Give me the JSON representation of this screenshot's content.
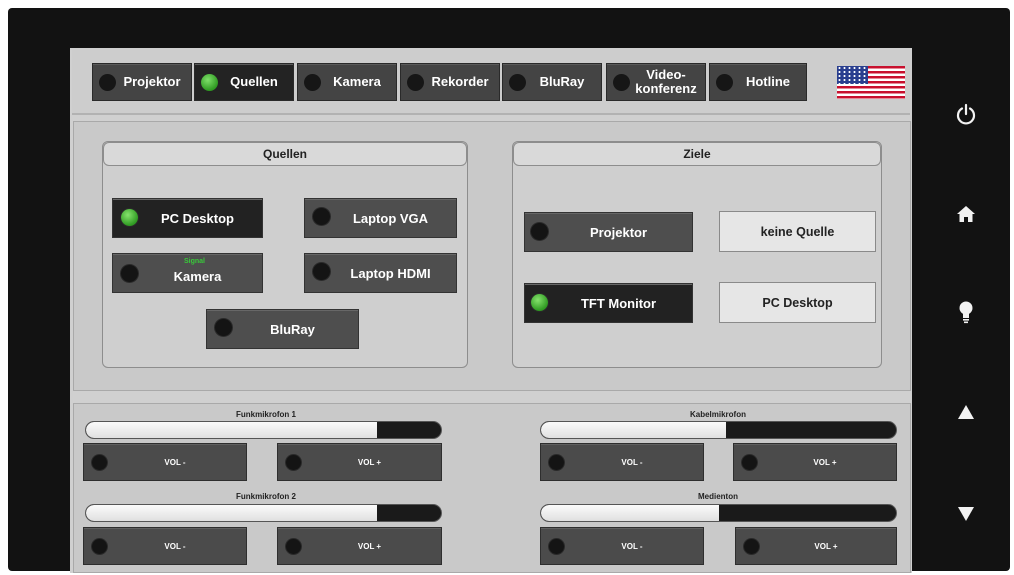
{
  "nav": [
    {
      "label": "Projektor",
      "active": false
    },
    {
      "label": "Quellen",
      "active": true
    },
    {
      "label": "Kamera",
      "active": false
    },
    {
      "label": "Rekorder",
      "active": false
    },
    {
      "label": "BluRay",
      "active": false
    },
    {
      "label": "Video-\nkonferenz",
      "active": false
    },
    {
      "label": "Hotline",
      "active": false
    }
  ],
  "language_flag": "us-flag-icon",
  "sources": {
    "title": "Quellen",
    "buttons": [
      {
        "label": "PC Desktop",
        "active": true
      },
      {
        "label": "Laptop VGA",
        "active": false
      },
      {
        "label": "Kamera",
        "active": false,
        "note": "Signal"
      },
      {
        "label": "Laptop HDMI",
        "active": false
      },
      {
        "label": "BluRay",
        "active": false
      }
    ]
  },
  "targets": {
    "title": "Ziele",
    "rows": [
      {
        "label": "Projektor",
        "active": false,
        "current_source": "keine Quelle"
      },
      {
        "label": "TFT Monitor",
        "active": true,
        "current_source": "PC Desktop"
      }
    ]
  },
  "audio": [
    {
      "name": "Funkmikrofon 1",
      "level": 0.82,
      "vol_down": "VOL -",
      "vol_up": "VOL +"
    },
    {
      "name": "Kabelmikrofon",
      "level": 0.52,
      "vol_down": "VOL -",
      "vol_up": "VOL +"
    },
    {
      "name": "Funkmikrofon 2",
      "level": 0.82,
      "vol_down": "VOL -",
      "vol_up": "VOL +"
    },
    {
      "name": "Medienton",
      "level": 0.5,
      "vol_down": "VOL -",
      "vol_up": "VOL +"
    }
  ],
  "side_controls": [
    "power-icon",
    "home-icon",
    "lightbulb-icon",
    "arrow-up-icon",
    "arrow-down-icon"
  ],
  "colors": {
    "led_on": "#3aa82b",
    "button_bg": "#4e4e4e",
    "panel_bg": "#c9c9c9",
    "bezel": "#121212"
  }
}
